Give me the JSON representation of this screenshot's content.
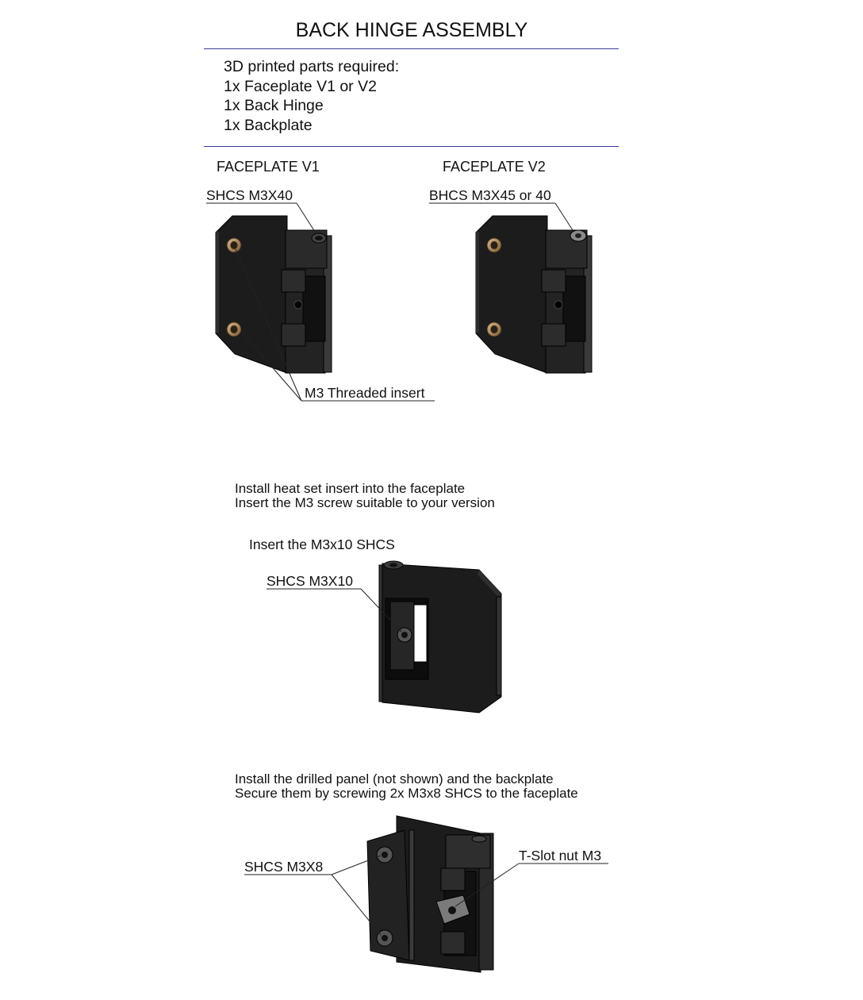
{
  "title": "BACK HINGE ASSEMBLY",
  "parts": {
    "heading": "3D printed parts required:",
    "items": [
      "1x Faceplate V1 or V2",
      "1x Back Hinge",
      "1x Backplate"
    ]
  },
  "versions": {
    "v1": {
      "label": "FACEPLATE V1",
      "screw": "SHCS M3X40"
    },
    "v2": {
      "label": "FACEPLATE V2",
      "screw": "BHCS M3X45 or 40"
    },
    "insert_label": "M3 Threaded insert"
  },
  "step1": {
    "line1": "Install heat set insert into the faceplate",
    "line2": "Insert the M3 screw suitable to your version"
  },
  "step2": {
    "heading": "Insert the M3x10 SHCS",
    "screw": "SHCS M3X10"
  },
  "step3": {
    "line1": "Install the drilled panel (not shown) and the backplate",
    "line2": "Secure them by screwing 2x M3x8 SHCS to the faceplate",
    "screw": "SHCS M3X8",
    "nut": "T-Slot nut M3"
  }
}
